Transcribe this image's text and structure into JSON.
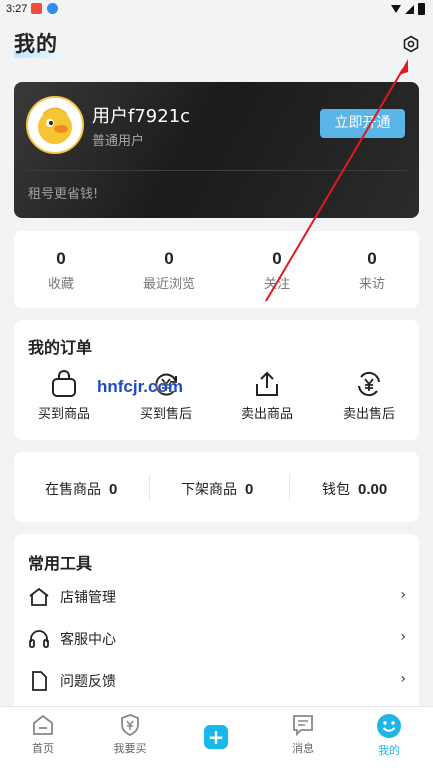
{
  "status_bar": {
    "time": "3:27"
  },
  "header": {
    "title": "我的"
  },
  "vip_card": {
    "username": "用户f7921c",
    "user_type": "普通用户",
    "open_button": "立即开通",
    "slogan": "租号更省钱!"
  },
  "stats": [
    {
      "value": "0",
      "label": "收藏"
    },
    {
      "value": "0",
      "label": "最近浏览"
    },
    {
      "value": "0",
      "label": "关注"
    },
    {
      "value": "0",
      "label": "来访"
    }
  ],
  "orders": {
    "title": "我的订单",
    "items": [
      {
        "label": "买到商品",
        "icon": "shopping-bag-icon"
      },
      {
        "label": "买到售后",
        "icon": "refresh-yen-icon"
      },
      {
        "label": "卖出商品",
        "icon": "upload-icon"
      },
      {
        "label": "卖出售后",
        "icon": "refresh-yen-icon"
      }
    ]
  },
  "wallet": {
    "on_sale_label": "在售商品",
    "on_sale_value": "0",
    "off_shelf_label": "下架商品",
    "off_shelf_value": "0",
    "wallet_label": "钱包",
    "wallet_value": "0.00"
  },
  "tools": {
    "title": "常用工具",
    "items": [
      {
        "label": "店铺管理",
        "icon": "store-icon"
      },
      {
        "label": "客服中心",
        "icon": "headset-icon"
      },
      {
        "label": "问题反馈",
        "icon": "document-icon"
      }
    ],
    "chevron": "›"
  },
  "watermark": "hnfcjr.com",
  "tabbar": {
    "tabs": [
      {
        "label": "首页",
        "icon": "home-icon"
      },
      {
        "label": "我要买",
        "icon": "shield-yen-icon"
      },
      {
        "label": "",
        "icon": "plus-icon"
      },
      {
        "label": "消息",
        "icon": "message-icon"
      },
      {
        "label": "我的",
        "icon": "smile-icon"
      }
    ],
    "plus_symbol": "+",
    "active_color": "#1fb5e5"
  },
  "colors": {
    "accent": "#5ab5e6",
    "annotation_arrow": "#e0191f"
  }
}
